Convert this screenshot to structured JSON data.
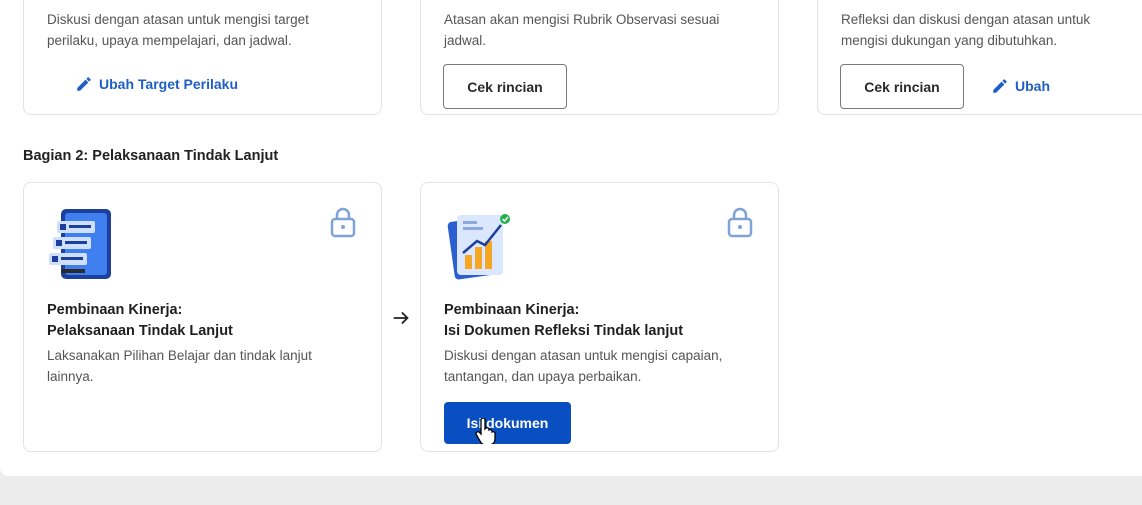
{
  "top_cards": [
    {
      "desc_line1": "Diskusi dengan atasan untuk mengisi target",
      "desc_line2": "perilaku, upaya mempelajari, dan jadwal.",
      "link_label": "Ubah Target Perilaku"
    },
    {
      "desc_line1": "Atasan akan mengisi Rubrik Observasi sesuai",
      "desc_line2": "jadwal.",
      "button_label": "Cek rincian"
    },
    {
      "desc_line1": "Refleksi dan diskusi dengan atasan untuk",
      "desc_line2": "mengisi dukungan yang dibutuhkan.",
      "button_label": "Cek rincian",
      "link_label": "Ubah"
    }
  ],
  "section2": {
    "title": "Bagian 2: Pelaksanaan Tindak Lanjut",
    "cards": [
      {
        "title_line1": "Pembinaan Kinerja:",
        "title_line2": "Pelaksanaan Tindak Lanjut",
        "desc_line1": "Laksanakan Pilihan Belajar dan tindak lanjut",
        "desc_line2": "lainnya.",
        "icon": "lock-icon"
      },
      {
        "title_line1": "Pembinaan Kinerja:",
        "title_line2": "Isi Dokumen Refleksi Tindak lanjut",
        "desc_line1": "Diskusi dengan atasan untuk mengisi capaian,",
        "desc_line2": "tantangan, dan upaya perbaikan.",
        "button_label": "Isi dokumen",
        "icon": "lock-icon"
      }
    ]
  },
  "colors": {
    "primary": "#0a4fc2",
    "link": "#1f5fc4",
    "lock": "#7fa3d9"
  }
}
